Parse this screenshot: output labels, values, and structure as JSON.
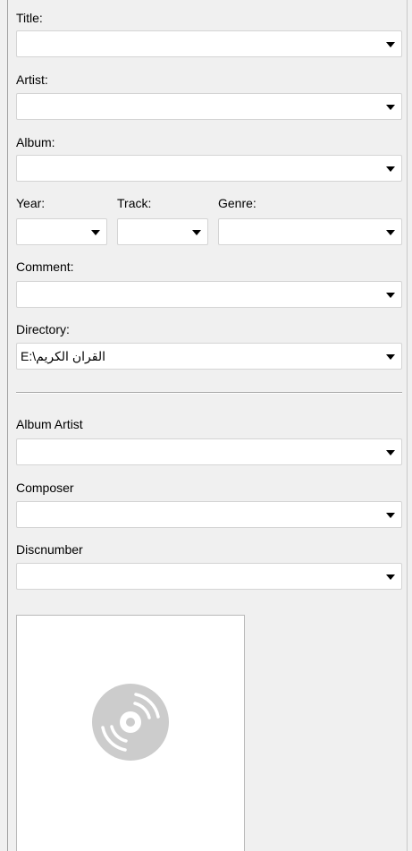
{
  "fields": {
    "title": {
      "label": "Title:",
      "value": ""
    },
    "artist": {
      "label": "Artist:",
      "value": ""
    },
    "album": {
      "label": "Album:",
      "value": ""
    },
    "year": {
      "label": "Year:",
      "value": ""
    },
    "track": {
      "label": "Track:",
      "value": ""
    },
    "genre": {
      "label": "Genre:",
      "value": ""
    },
    "comment": {
      "label": "Comment:",
      "value": ""
    },
    "directory": {
      "label": "Directory:",
      "value": "E:\\القران الكريم"
    },
    "album_artist": {
      "label": "Album Artist",
      "value": ""
    },
    "composer": {
      "label": "Composer",
      "value": ""
    },
    "discnumber": {
      "label": "Discnumber",
      "value": ""
    }
  },
  "cover": {
    "icon": "disc-icon",
    "icon_color": "#cccccc"
  }
}
